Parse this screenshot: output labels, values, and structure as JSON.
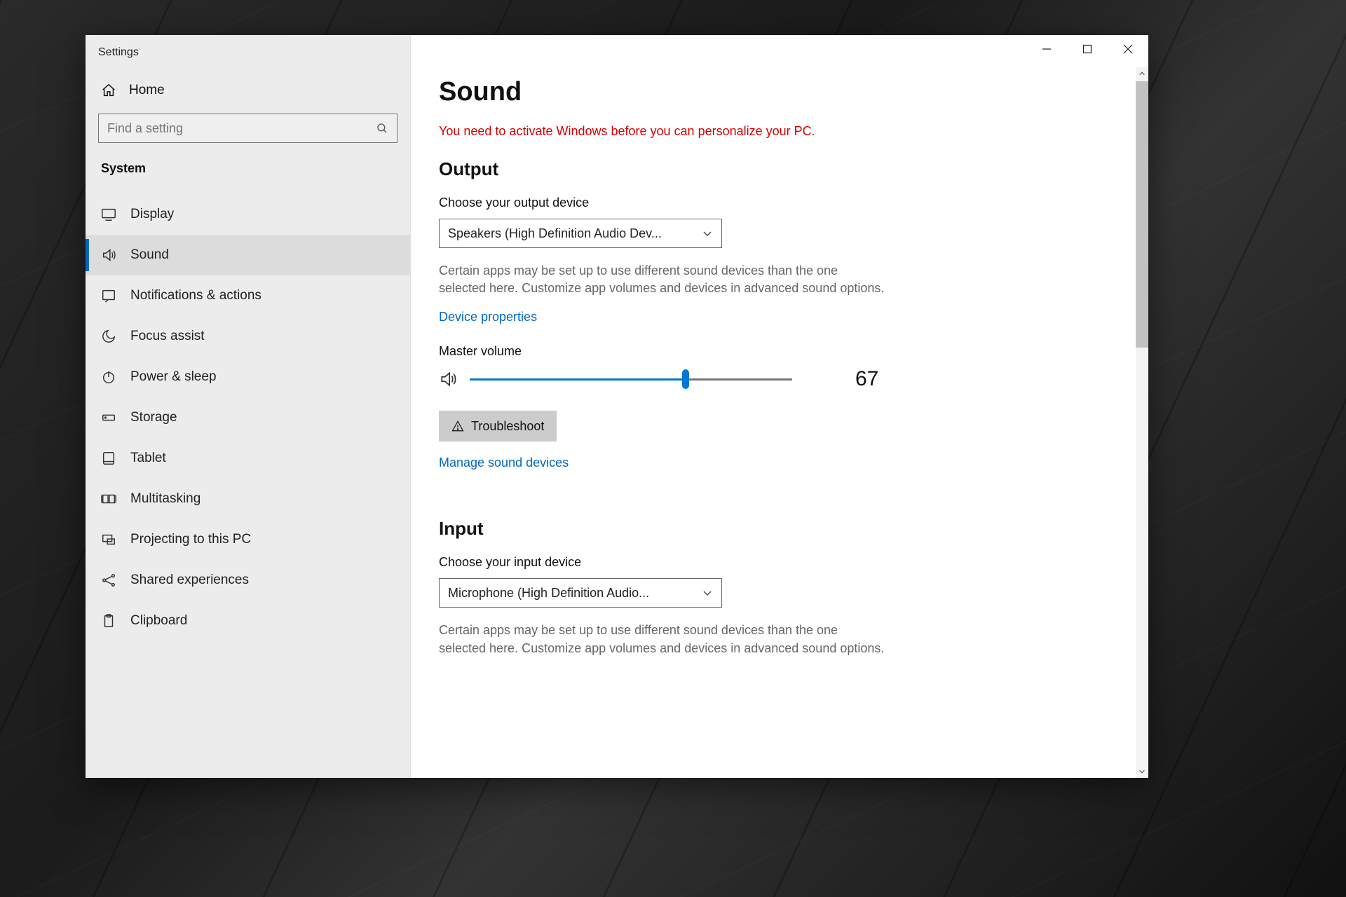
{
  "window": {
    "title": "Settings"
  },
  "sidebar": {
    "home_label": "Home",
    "search_placeholder": "Find a setting",
    "category_label": "System",
    "items": [
      {
        "label": "Display"
      },
      {
        "label": "Sound"
      },
      {
        "label": "Notifications & actions"
      },
      {
        "label": "Focus assist"
      },
      {
        "label": "Power & sleep"
      },
      {
        "label": "Storage"
      },
      {
        "label": "Tablet"
      },
      {
        "label": "Multitasking"
      },
      {
        "label": "Projecting to this PC"
      },
      {
        "label": "Shared experiences"
      },
      {
        "label": "Clipboard"
      }
    ],
    "active_index": 1
  },
  "page": {
    "title": "Sound",
    "activation_warning": "You need to activate Windows before you can personalize your PC.",
    "output": {
      "heading": "Output",
      "choose_label": "Choose your output device",
      "device_selected": "Speakers (High Definition Audio Dev...",
      "help_text": "Certain apps may be set up to use different sound devices than the one selected here. Customize app volumes and devices in advanced sound options.",
      "device_properties_link": "Device properties",
      "master_volume_label": "Master volume",
      "master_volume_value": 67,
      "troubleshoot_label": "Troubleshoot",
      "manage_devices_link": "Manage sound devices"
    },
    "input": {
      "heading": "Input",
      "choose_label": "Choose your input device",
      "device_selected": "Microphone (High Definition Audio...",
      "help_text": "Certain apps may be set up to use different sound devices than the one selected here. Customize app volumes and devices in advanced sound options."
    }
  }
}
